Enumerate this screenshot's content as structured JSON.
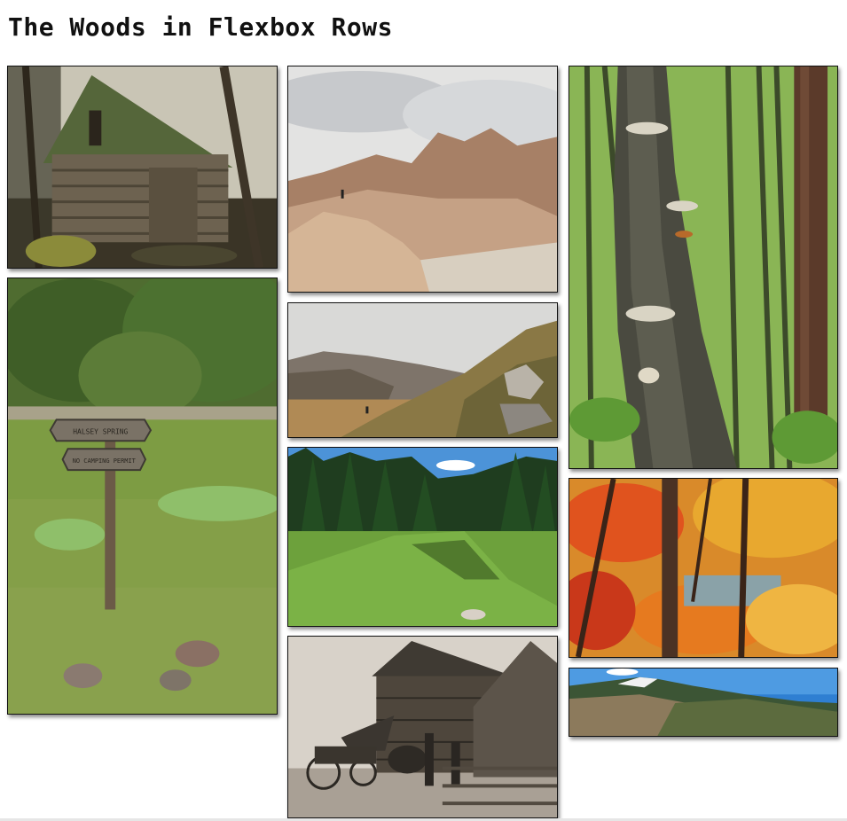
{
  "page": {
    "title": "The Woods in Flexbox Rows"
  },
  "photos": [
    {
      "id": "cabin",
      "sign_text": ""
    },
    {
      "id": "desert-mountains"
    },
    {
      "id": "tall-forest-fungus"
    },
    {
      "id": "trail-sign-meadow",
      "sign_lines": [
        "HALSEY SPRING",
        "NO CAMPING PERMIT"
      ]
    },
    {
      "id": "misty-hills-hiker"
    },
    {
      "id": "pine-meadow"
    },
    {
      "id": "autumn-lake"
    },
    {
      "id": "old-log-house-wagon"
    },
    {
      "id": "snowy-peak-panorama"
    }
  ]
}
